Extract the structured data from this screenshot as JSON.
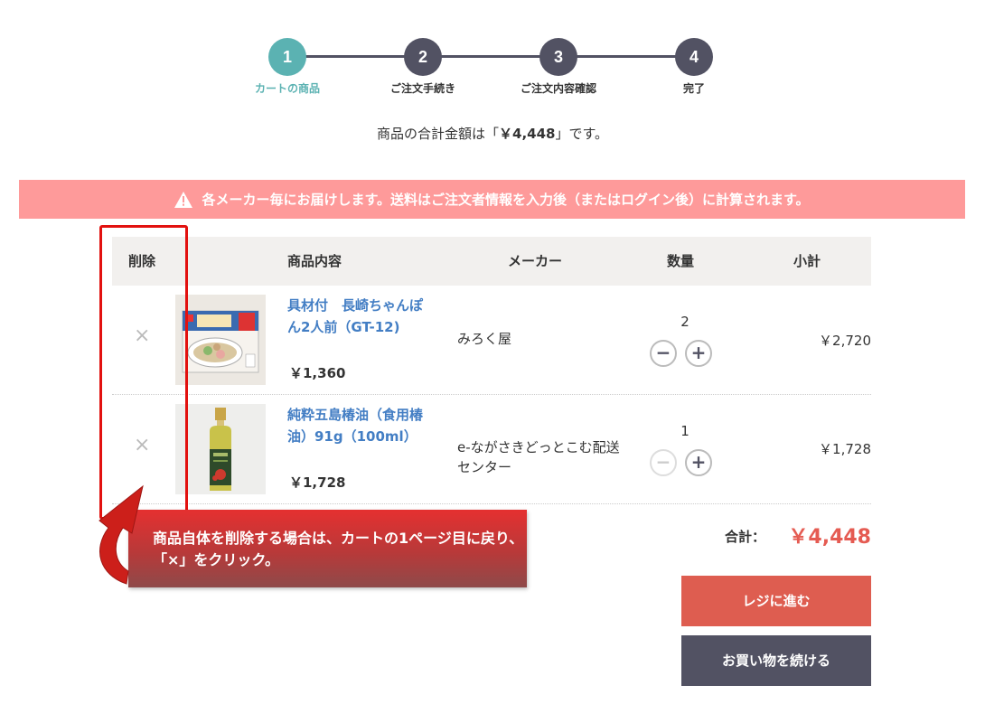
{
  "steps": [
    {
      "number": "1",
      "label": "カートの商品"
    },
    {
      "number": "2",
      "label": "ご注文手続き"
    },
    {
      "number": "3",
      "label": "ご注文内容確認"
    },
    {
      "number": "4",
      "label": "完了"
    }
  ],
  "total_message": {
    "prefix": "商品の合計金額は「",
    "amount": "￥4,448",
    "suffix": "」です。"
  },
  "alert": {
    "icon": "warning-icon",
    "text": "各メーカー毎にお届けします。送料はご注文者情報を入力後（またはログイン後）に計算されます。"
  },
  "table": {
    "headers": {
      "delete": "削除",
      "content": "商品内容",
      "maker": "メーカー",
      "quantity": "数量",
      "subtotal": "小計"
    },
    "rows": [
      {
        "delete_icon": "×",
        "name": "具材付　長崎ちゃんぽん2人前（GT-12)",
        "price": "￥1,360",
        "maker": "みろく屋",
        "quantity": "2",
        "minus": "−",
        "plus": "+",
        "subtotal": "￥2,720"
      },
      {
        "delete_icon": "×",
        "name": "純粋五島椿油（食用椿油）91g（100ml）",
        "price": "￥1,728",
        "maker": "e-ながさきどっとこむ配送センター",
        "quantity": "1",
        "minus": "−",
        "plus": "+",
        "subtotal": "￥1,728"
      }
    ]
  },
  "summary": {
    "label": "合計：",
    "value": "￥4,448"
  },
  "buttons": {
    "checkout": "レジに進む",
    "continue": "お買い物を続ける"
  },
  "annotation": {
    "text": "商品自体を削除する場合は、カートの1ページ目に戻り、「×」をクリック。"
  },
  "colors": {
    "accent": "#5bb2b2",
    "dark": "#525263",
    "alert": "#fe9a9a",
    "link": "#437ec4",
    "price_red": "#e55b52",
    "checkout": "#de5d50"
  }
}
